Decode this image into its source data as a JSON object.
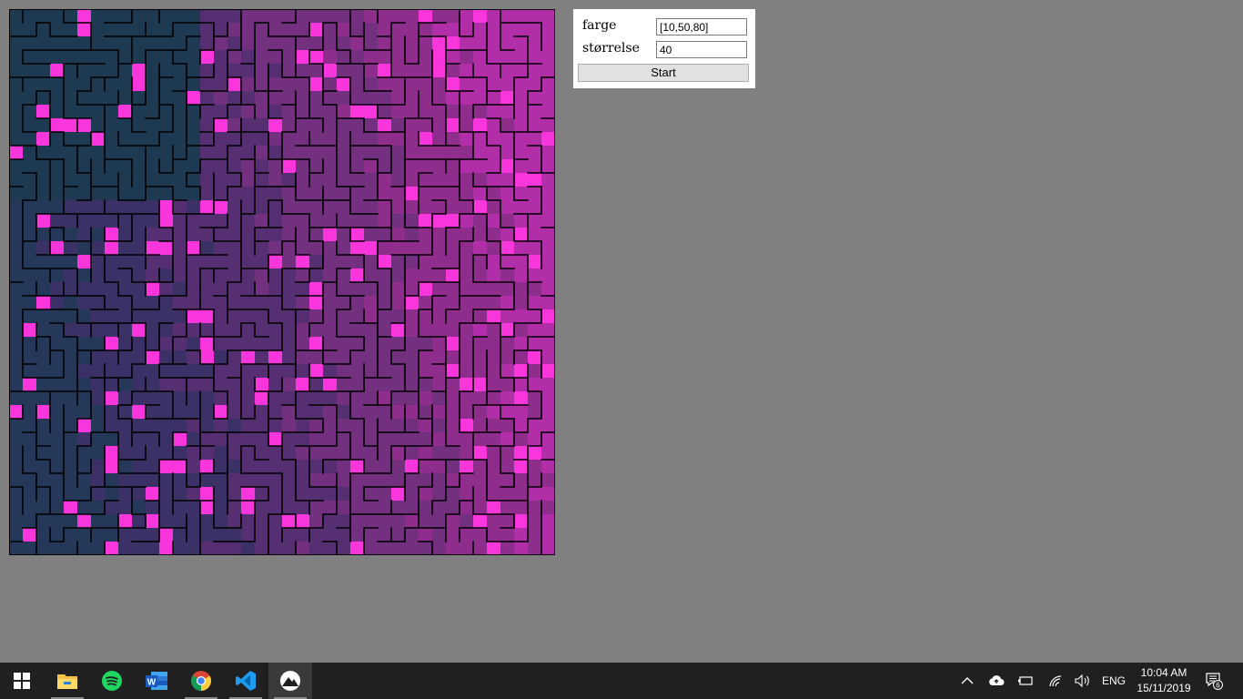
{
  "form": {
    "color_label": "farge",
    "color_value": "[10,50,80]",
    "size_label": "størrelse",
    "size_value": "40",
    "start_label": "Start"
  },
  "maze": {
    "grid_size": 40,
    "base_color": "#1e3a52",
    "path_colors": [
      "#26385a",
      "#3c3166",
      "#552f72",
      "#72307f",
      "#8e2d8c",
      "#b22ea8"
    ],
    "highlight_color": "#f936dc",
    "wall_color": "#000000"
  },
  "taskbar": {
    "apps": [
      {
        "name": "start-button",
        "icon": "windows-logo"
      },
      {
        "name": "file-explorer",
        "icon": "folder-icon"
      },
      {
        "name": "spotify",
        "icon": "spotify-icon"
      },
      {
        "name": "word",
        "icon": "word-icon"
      },
      {
        "name": "chrome",
        "icon": "chrome-icon"
      },
      {
        "name": "vscode",
        "icon": "vscode-icon"
      },
      {
        "name": "processing",
        "icon": "processing-icon"
      }
    ],
    "language": "ENG",
    "time": "10:04 AM",
    "date": "15/11/2019",
    "notification_count": "6"
  }
}
